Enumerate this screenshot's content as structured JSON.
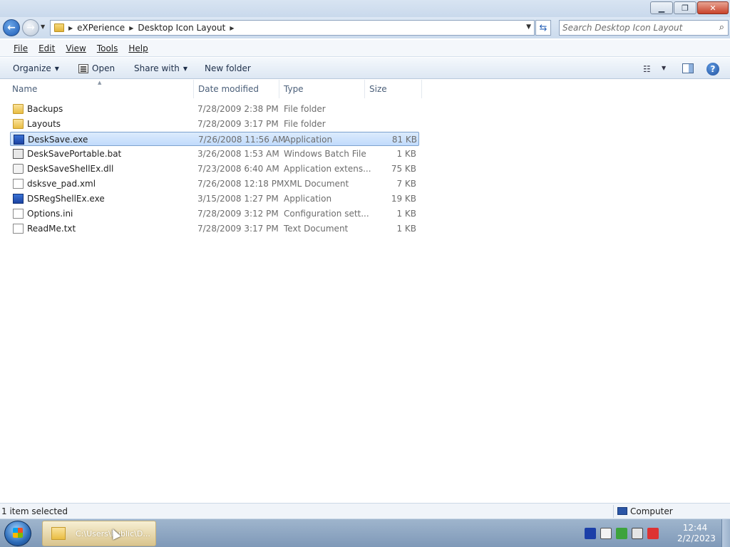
{
  "window": {
    "minimize": "▁",
    "maximize": "❐",
    "close": "✕"
  },
  "address": {
    "crumbs": [
      "eXPerience",
      "Desktop Icon Layout"
    ],
    "search_placeholder": "Search Desktop Icon Layout"
  },
  "menu": [
    "File",
    "Edit",
    "View",
    "Tools",
    "Help"
  ],
  "toolbar": {
    "organize": "Organize",
    "open": "Open",
    "share_with": "Share with",
    "new_folder": "New folder"
  },
  "columns": {
    "name": "Name",
    "date": "Date modified",
    "type": "Type",
    "size": "Size"
  },
  "files": [
    {
      "name": "Backups",
      "date": "7/28/2009 2:38 PM",
      "type": "File folder",
      "size": "",
      "icon": "folder"
    },
    {
      "name": "Layouts",
      "date": "7/28/2009 3:17 PM",
      "type": "File folder",
      "size": "",
      "icon": "folder"
    },
    {
      "name": "DeskSave.exe",
      "date": "7/26/2008 11:56 AM",
      "type": "Application",
      "size": "81 KB",
      "icon": "exe",
      "selected": true
    },
    {
      "name": "DeskSavePortable.bat",
      "date": "3/26/2008 1:53 AM",
      "type": "Windows Batch File",
      "size": "1 KB",
      "icon": "bat"
    },
    {
      "name": "DeskSaveShellEx.dll",
      "date": "7/23/2008 6:40 AM",
      "type": "Application extens...",
      "size": "75 KB",
      "icon": "dll"
    },
    {
      "name": "dsksve_pad.xml",
      "date": "7/26/2008 12:18 PM",
      "type": "XML Document",
      "size": "7 KB",
      "icon": "doc"
    },
    {
      "name": "DSRegShellEx.exe",
      "date": "3/15/2008 1:27 PM",
      "type": "Application",
      "size": "19 KB",
      "icon": "exe"
    },
    {
      "name": "Options.ini",
      "date": "7/28/2009 3:12 PM",
      "type": "Configuration sett...",
      "size": "1 KB",
      "icon": "doc"
    },
    {
      "name": "ReadMe.txt",
      "date": "7/28/2009 3:17 PM",
      "type": "Text Document",
      "size": "1 KB",
      "icon": "doc"
    }
  ],
  "status": {
    "selection": "1 item selected",
    "location": "Computer"
  },
  "taskbar": {
    "task_label": "C:\\Users\\Public\\D...",
    "time": "12:44",
    "date": "2/2/2023"
  }
}
